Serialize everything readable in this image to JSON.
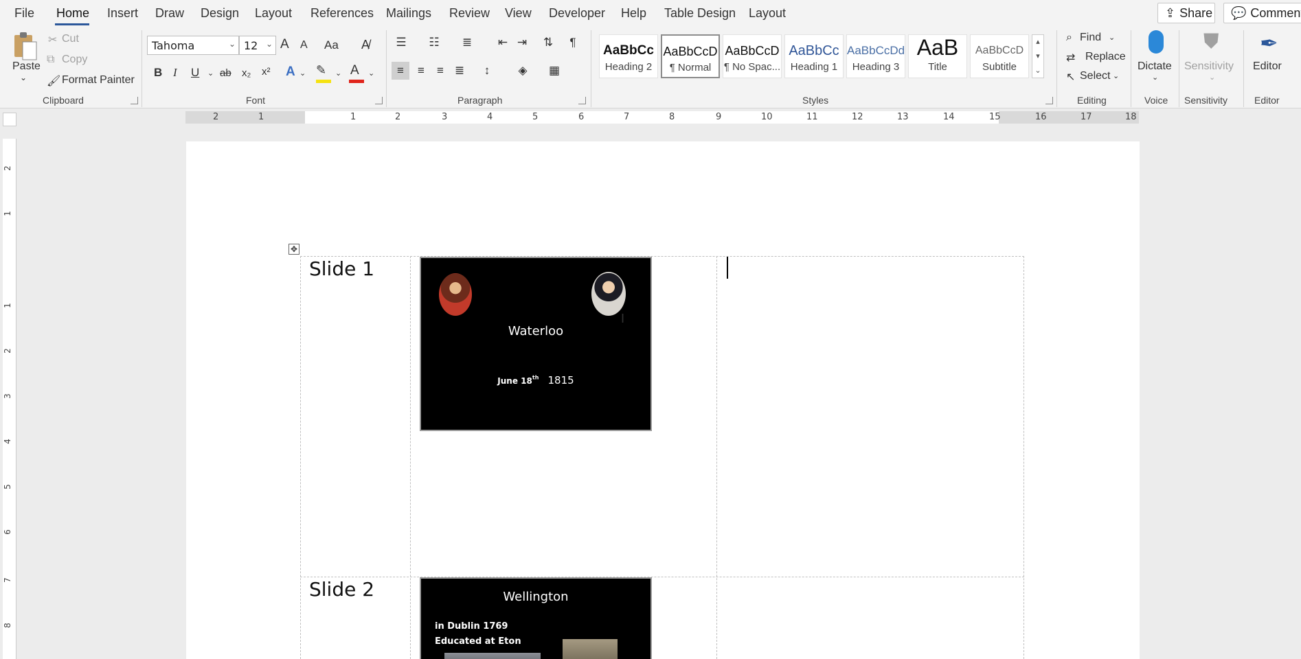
{
  "tabs": [
    {
      "label": "File"
    },
    {
      "label": "Home"
    },
    {
      "label": "Insert"
    },
    {
      "label": "Draw"
    },
    {
      "label": "Design"
    },
    {
      "label": "Layout"
    },
    {
      "label": "References"
    },
    {
      "label": "Mailings"
    },
    {
      "label": "Review"
    },
    {
      "label": "View"
    },
    {
      "label": "Developer"
    },
    {
      "label": "Help"
    },
    {
      "label": "Table Design"
    },
    {
      "label": "Layout"
    }
  ],
  "topright": {
    "share": "Share",
    "comments": "Comments"
  },
  "clipboard": {
    "paste": "Paste",
    "cut": "Cut",
    "copy": "Copy",
    "format_painter": "Format Painter",
    "group": "Clipboard"
  },
  "font": {
    "name": "Tahoma",
    "size": "12",
    "group": "Font",
    "bold": "B",
    "italic": "I",
    "underline": "U",
    "strike": "ab",
    "sub": "x₂",
    "sup": "x²",
    "grow": "A",
    "shrink": "A",
    "case": "Aa",
    "font_color_accent": "#e0241b",
    "highlight_accent": "#f5e211"
  },
  "paragraph": {
    "group": "Paragraph"
  },
  "styles": {
    "group": "Styles",
    "items": [
      {
        "sample": "AaBbCc",
        "name": "Heading 2"
      },
      {
        "sample": "AaBbCcD",
        "name": "¶ Normal"
      },
      {
        "sample": "AaBbCcD",
        "name": "¶ No Spac..."
      },
      {
        "sample": "AaBbCc",
        "name": "Heading 1"
      },
      {
        "sample": "AaBbCcDd",
        "name": "Heading 3"
      },
      {
        "sample": "AaB",
        "name": "Title"
      },
      {
        "sample": "AaBbCcD",
        "name": "Subtitle"
      }
    ]
  },
  "editing": {
    "find": "Find",
    "replace": "Replace",
    "select": "Select",
    "group": "Editing"
  },
  "voice": {
    "dictate": "Dictate",
    "group": "Voice"
  },
  "sensitivity": {
    "label": "Sensitivity",
    "group": "Sensitivity"
  },
  "editor": {
    "label": "Editor",
    "group": "Editor"
  },
  "ruler": {
    "h_numbers": [
      "2",
      "1",
      "1",
      "2",
      "3",
      "4",
      "5",
      "6",
      "7",
      "8",
      "9",
      "10",
      "11",
      "12",
      "13",
      "14",
      "15",
      "16",
      "17",
      "18"
    ],
    "v_numbers": [
      "2",
      "1",
      "1",
      "2",
      "3",
      "4",
      "5",
      "6",
      "7",
      "8"
    ]
  },
  "document": {
    "rows": [
      {
        "label": "Slide 1",
        "slide": {
          "title": "Waterloo",
          "date_prefix": "June 18",
          "date_sup": "th",
          "year": "1815"
        }
      },
      {
        "label": "Slide 2",
        "slide": {
          "title": "Wellington",
          "line1": "in Dublin 1769",
          "line2": "Educated at Eton"
        }
      }
    ]
  }
}
